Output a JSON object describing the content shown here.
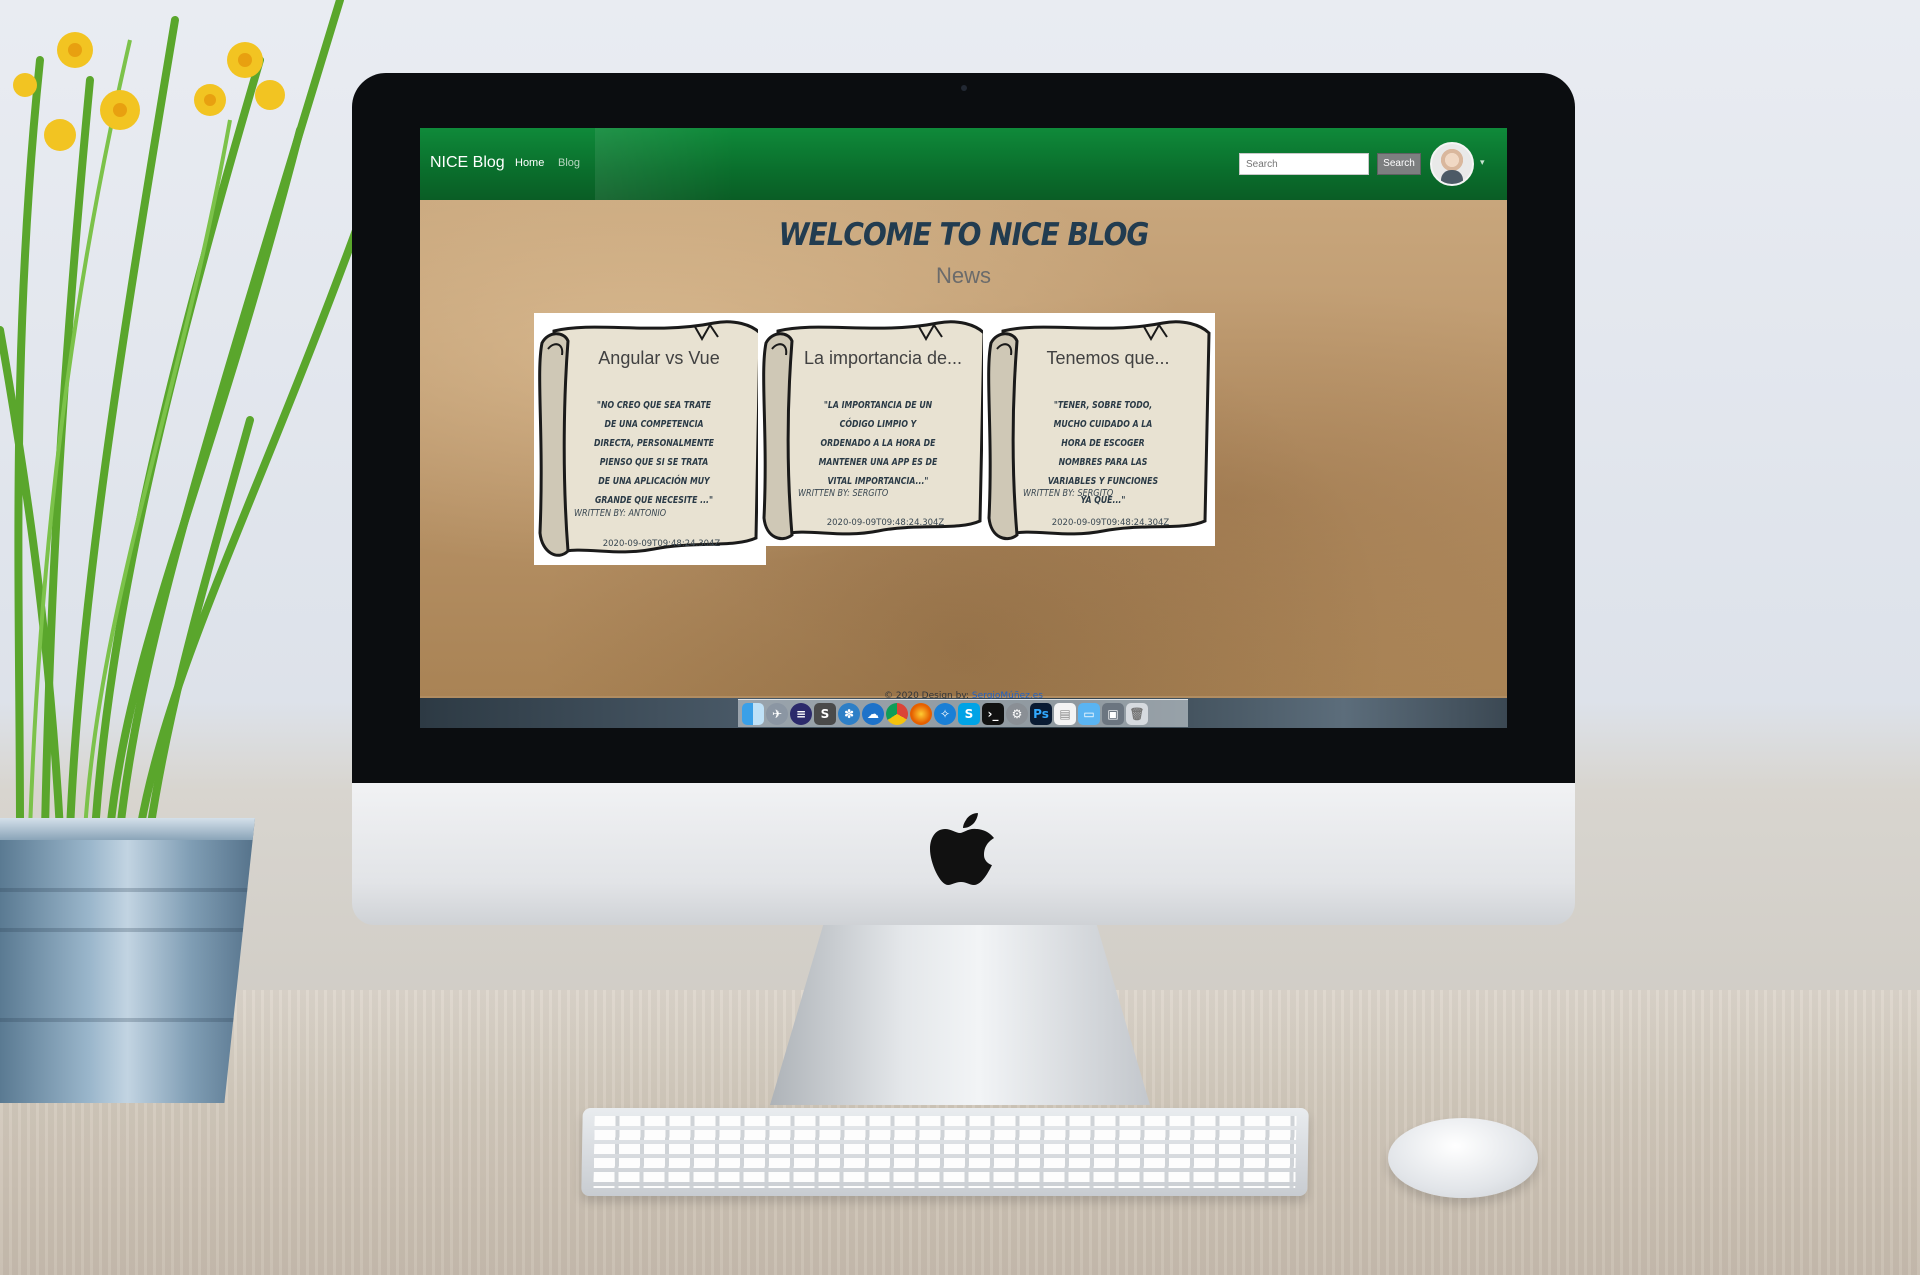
{
  "nav": {
    "brand": "NICE Blog",
    "links": [
      "Home",
      "Blog"
    ],
    "search_placeholder": "Search",
    "search_button": "Search"
  },
  "hero": {
    "title": "WELCOME TO NICE BLOG",
    "subtitle": "News"
  },
  "cards": [
    {
      "title": "Angular vs Vue",
      "quote": "\"No creo que sea trate de una competencia directa, personalmente pienso que si se trata de una aplicación muy grande que necesite ...\"",
      "author": "Written by: Antonio",
      "date": "2020-09-09T09:48:24.304Z"
    },
    {
      "title": "La importancia de...",
      "quote": "\"La importancia de un código limpio y ordenado a la hora de mantener una app es de vital importancia...\"",
      "author": "Written by: Sergito",
      "date": "2020-09-09T09:48:24.304Z"
    },
    {
      "title": "Tenemos que...",
      "quote": "\"Tener, sobre todo, mucho cuidado a la hora de escoger nombres para las variables y funciones ya que...\"",
      "author": "Written by: Sergito",
      "date": "2020-09-09T09:48:24.304Z"
    }
  ],
  "footer": {
    "text": "© 2020 Design by:",
    "link": "SergioMúñez.es"
  },
  "dock": {
    "icons": [
      "finder-icon",
      "launchpad-icon",
      "eclipse-icon",
      "sublime-icon",
      "vscode-icon",
      "vpn-icon",
      "chrome-icon",
      "firefox-icon",
      "safari-icon",
      "skype-icon",
      "terminal-icon",
      "settings-icon",
      "photoshop-icon",
      "document-icon",
      "folder-icon",
      "screenshot-icon",
      "trash-icon"
    ],
    "labels": {
      "skype": "S",
      "photoshop": "Ps"
    }
  },
  "colors": {
    "navbar": "#0a6e2c",
    "parchment": "#b99469",
    "title": "#223c50"
  }
}
